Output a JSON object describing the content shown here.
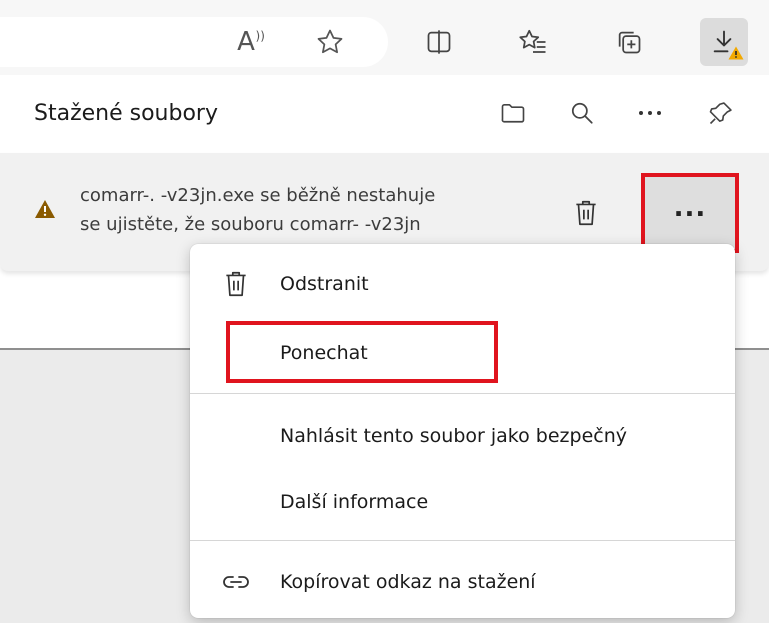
{
  "colors": {
    "highlight": "#e0141e",
    "warning": "#8a5a00",
    "badge": "#f2a900"
  },
  "toolbar": {
    "icons": [
      "read-aloud-icon",
      "favorite-star-icon",
      "split-screen-icon",
      "favorites-list-icon",
      "collections-icon",
      "downloads-icon"
    ],
    "read_aloud_glyph": "A",
    "read_aloud_sup": "))"
  },
  "downloads": {
    "title": "Stažené soubory",
    "header_icons": [
      "folder-icon",
      "search-icon",
      "more-options-icon",
      "pin-icon"
    ],
    "item": {
      "line1": "comarr-.       -v23jn.exe se běžně nestahuje",
      "line2": "se ujistěte, že souboru comarr-         -v23jn",
      "more_label": "..."
    }
  },
  "menu": {
    "items": [
      {
        "label": "Odstranit",
        "icon": "trash-icon"
      },
      {
        "label": "Ponechat",
        "icon": ""
      },
      {
        "label": "Nahlásit tento soubor jako bezpečný",
        "icon": ""
      },
      {
        "label": "Další informace",
        "icon": ""
      },
      {
        "label": "Kopírovat odkaz na stažení",
        "icon": "link-icon"
      }
    ]
  }
}
